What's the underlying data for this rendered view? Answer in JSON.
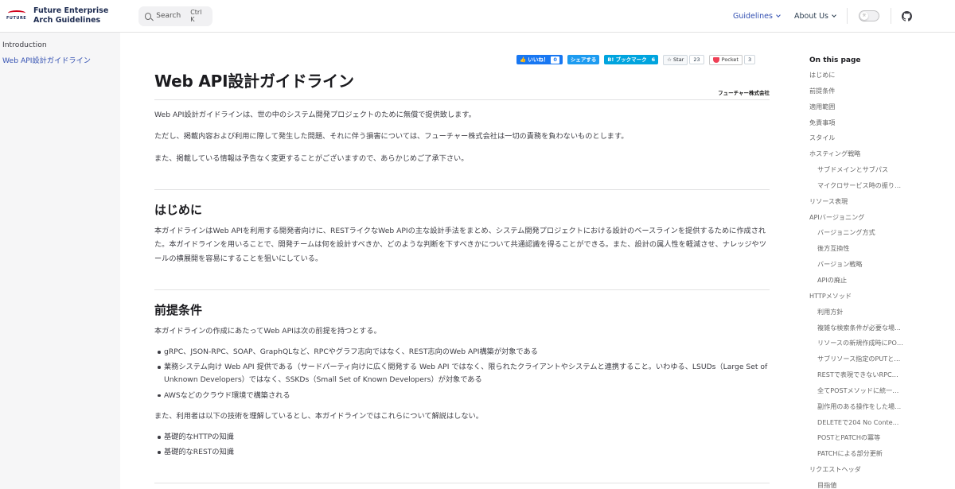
{
  "brand": {
    "logo_text": "FUTURE",
    "title_line1": "Future Enterprise",
    "title_line2": "Arch Guidelines"
  },
  "search": {
    "label": "Search",
    "shortcut": "Ctrl K"
  },
  "nav": {
    "guidelines": "Guidelines",
    "about": "About Us",
    "theme_icon": "sun-icon",
    "github_icon": "github-icon"
  },
  "sidebar": {
    "items": [
      {
        "label": "Introduction",
        "active": false
      },
      {
        "label": "Web API設計ガイドライン",
        "active": true
      }
    ]
  },
  "share": {
    "facebook_label": "いいね！",
    "facebook_count": "0",
    "twitter_label": "シェアする",
    "hatena_label": "B! ブックマーク",
    "hatena_count": "6",
    "github_label": "Star",
    "github_count": "23",
    "pocket_label": "Pocket",
    "pocket_count": "3"
  },
  "article": {
    "title": "Web API設計ガイドライン",
    "company": "フューチャー株式会社",
    "intro": [
      "Web API設計ガイドラインは、世の中のシステム開発プロジェクトのために無償で提供致します。",
      "ただし、掲載内容および利用に際して発生した問題、それに伴う損害については、フューチャー株式会社は一切の責務を負わないものとします。",
      "また、掲載している情報は予告なく変更することがございますので、あらかじめご了承下さい。"
    ],
    "section1": {
      "heading": "はじめに",
      "body": "本ガイドラインはWeb APIを利用する開発者向けに、RESTライクなWeb APIの主な設計手法をまとめ、システム開発プロジェクトにおける設計のベースラインを提供するために作成された。本ガイドラインを用いることで、開発チームは何を設計すべきか、どのような判断を下すべきかについて共通認識を得ることができる。また、設計の属人性を軽減させ、ナレッジやツールの横展開を容易にすることを狙いにしている。"
    },
    "section2": {
      "heading": "前提条件",
      "lead": "本ガイドラインの作成にあたってWeb APIは次の前提を持つとする。",
      "bullets": [
        "gRPC、JSON-RPC、SOAP、GraphQLなど、RPCやグラフ志向ではなく、REST志向のWeb API構築が対象である",
        "業務システム向け Web API 提供である（サードパーティ向けに広く開発する Web API ではなく、限られたクライアントやシステムと連携すること。いわゆる、LSUDs（Large Set of Unknown Developers）ではなく、SSKDs（Small Set of Known Developers）が対象である",
        "AWSなどのクラウド環境で構築される"
      ],
      "lead2": "また、利用者は以下の技術を理解しているとし、本ガイドラインではこれらについて解説はしない。",
      "bullets2": [
        "基礎的なHTTPの知識",
        "基礎的なRESTの知識"
      ]
    }
  },
  "toc": {
    "title": "On this page",
    "items": [
      {
        "label": "はじめに",
        "level": 1
      },
      {
        "label": "前提条件",
        "level": 1
      },
      {
        "label": "適用範囲",
        "level": 1
      },
      {
        "label": "免責事項",
        "level": 1
      },
      {
        "label": "スタイル",
        "level": 1
      },
      {
        "label": "ホスティング戦略",
        "level": 1
      },
      {
        "label": "サブドメインとサブパス",
        "level": 2
      },
      {
        "label": "マイクロサービス時の振り分け",
        "level": 2
      },
      {
        "label": "リソース表現",
        "level": 1
      },
      {
        "label": "APIバージョニング",
        "level": 1
      },
      {
        "label": "バージョニング方式",
        "level": 2
      },
      {
        "label": "後方互換性",
        "level": 2
      },
      {
        "label": "バージョン戦略",
        "level": 2
      },
      {
        "label": "APIの廃止",
        "level": 2
      },
      {
        "label": "HTTPメソッド",
        "level": 1
      },
      {
        "label": "利用方針",
        "level": 2
      },
      {
        "label": "複雑な検索条件が必要な場...",
        "level": 2
      },
      {
        "label": "リソースの新規作成時にPOS...",
        "level": 2
      },
      {
        "label": "サブリソース指定のPUTとPA...",
        "level": 2
      },
      {
        "label": "RESTで表現できないRPC的...",
        "level": 2
      },
      {
        "label": "全てPOSTメソッドに統一する...",
        "level": 2
      },
      {
        "label": "副作用のある操作をした場合...",
        "level": 2
      },
      {
        "label": "DELETEで204 No Conte...",
        "level": 2
      },
      {
        "label": "POSTとPATCHの冪等",
        "level": 2
      },
      {
        "label": "PATCHによる部分更新",
        "level": 2
      },
      {
        "label": "リクエストヘッダ",
        "level": 1
      },
      {
        "label": "目指値",
        "level": 2
      }
    ]
  }
}
